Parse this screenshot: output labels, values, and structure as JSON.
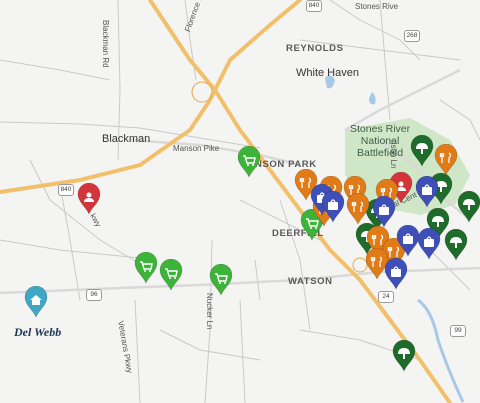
{
  "labels": {
    "reynolds": "REYNOLDS",
    "white_haven": "White Haven",
    "blackman": "Blackman",
    "manson_pike": "Manson Pike",
    "manson_park": "NSON PARK",
    "deerfield": "DEERFIEL",
    "watson": "WATSON",
    "park_line1": "Stones River",
    "park_line2": "National",
    "park_line3": "Battlefield",
    "blackman_rd": "Blackman Rd",
    "florence_rd": "Florence Rd",
    "stones_river_rd": "Stones Rive",
    "medical_ctr": "Medical Cent",
    "nucker_ln": "Nucker Ln",
    "veterans_pkwy": "Veterans Pkwy",
    "tone_ln": "nson Ln",
    "parkway_fragment": "kwy",
    "hwy_840_top": "840",
    "hwy_840_left": "840",
    "hwy_96": "96",
    "hwy_24": "24",
    "hwy_268": "268",
    "hwy_99": "99"
  },
  "brand": {
    "logo_text": "Del Webb"
  },
  "colors": {
    "home": "#3fa6c4",
    "grocery": "#3db33a",
    "hospital": "#d3363a",
    "park": "#1f6b2c",
    "restaurant": "#e07b18",
    "shopping": "#3e4fb8",
    "highway": "#f2c06b",
    "water": "#a7c9e8",
    "parkland": "#cfe6c7"
  },
  "markers": [
    {
      "type": "home",
      "icon": "house-icon"
    },
    {
      "type": "grocery",
      "icon": "cart-icon"
    },
    {
      "type": "grocery",
      "icon": "cart-icon"
    },
    {
      "type": "grocery",
      "icon": "cart-icon"
    },
    {
      "type": "grocery",
      "icon": "cart-icon"
    },
    {
      "type": "grocery",
      "icon": "cart-icon"
    },
    {
      "type": "hospital",
      "icon": "medical-cross-icon"
    },
    {
      "type": "hospital",
      "icon": "medical-cross-icon"
    },
    {
      "type": "park",
      "icon": "tree-icon"
    },
    {
      "type": "park",
      "icon": "tree-icon"
    },
    {
      "type": "park",
      "icon": "tree-icon"
    },
    {
      "type": "park",
      "icon": "tree-icon"
    },
    {
      "type": "park",
      "icon": "tree-icon"
    },
    {
      "type": "park",
      "icon": "tree-icon"
    },
    {
      "type": "park",
      "icon": "tree-icon"
    },
    {
      "type": "park",
      "icon": "tree-icon"
    },
    {
      "type": "restaurant",
      "icon": "utensils-icon"
    },
    {
      "type": "restaurant",
      "icon": "utensils-icon"
    },
    {
      "type": "restaurant",
      "icon": "utensils-icon"
    },
    {
      "type": "restaurant",
      "icon": "utensils-icon"
    },
    {
      "type": "restaurant",
      "icon": "utensils-icon"
    },
    {
      "type": "restaurant",
      "icon": "utensils-icon"
    },
    {
      "type": "restaurant",
      "icon": "utensils-icon"
    },
    {
      "type": "restaurant",
      "icon": "utensils-icon"
    },
    {
      "type": "restaurant",
      "icon": "utensils-icon"
    },
    {
      "type": "restaurant",
      "icon": "utensils-icon"
    },
    {
      "type": "shopping",
      "icon": "shopping-bag-icon"
    },
    {
      "type": "shopping",
      "icon": "shopping-bag-icon"
    },
    {
      "type": "shopping",
      "icon": "shopping-bag-icon"
    },
    {
      "type": "shopping",
      "icon": "shopping-bag-icon"
    },
    {
      "type": "shopping",
      "icon": "shopping-bag-icon"
    },
    {
      "type": "shopping",
      "icon": "shopping-bag-icon"
    },
    {
      "type": "shopping",
      "icon": "shopping-bag-icon"
    }
  ]
}
